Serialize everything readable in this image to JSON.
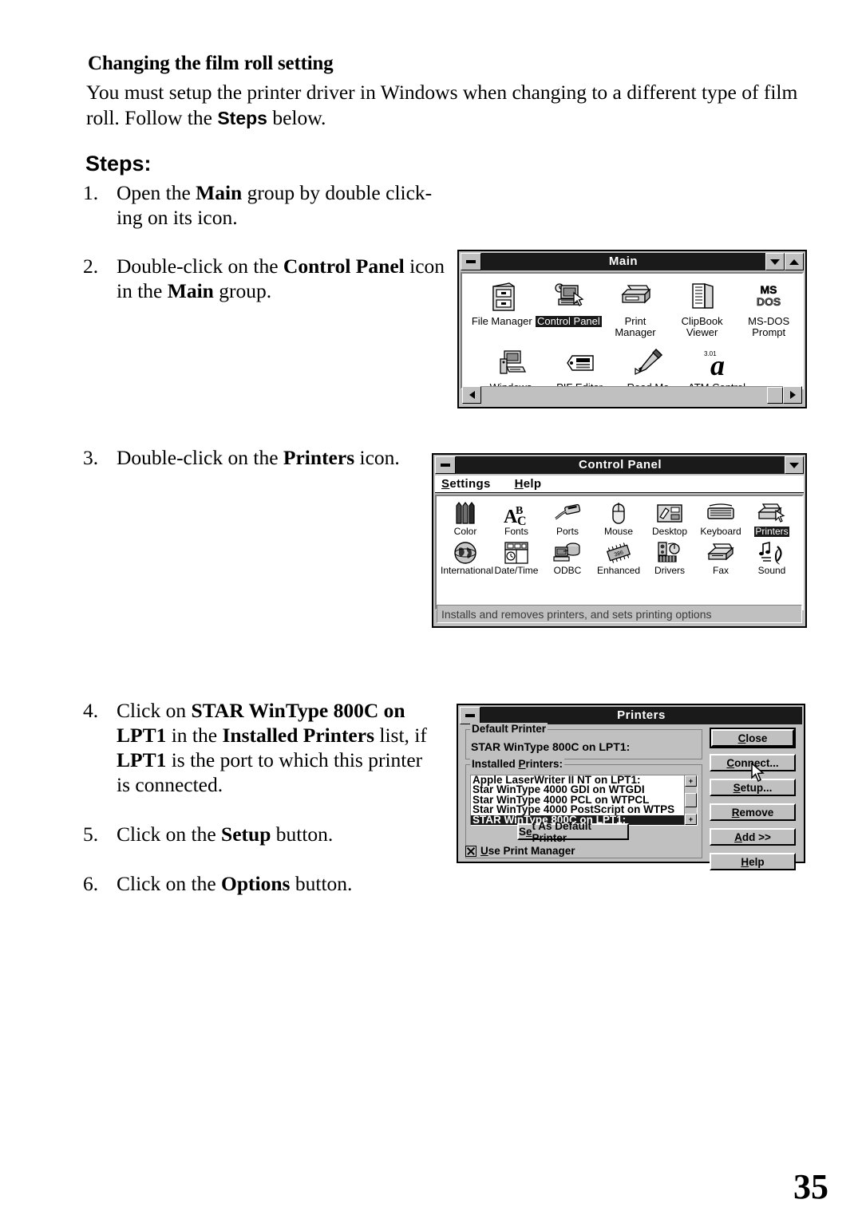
{
  "document": {
    "heading": "Changing the film roll setting",
    "intro_line1": "You must setup the printer driver in Windows when changing to a different type of film",
    "intro_line2_pre": "roll.  Follow the ",
    "intro_line2_bold": "Steps",
    "intro_line2_post": " below.",
    "steps_heading": "Steps:",
    "page_number": "35",
    "steps": [
      {
        "num": "1.",
        "parts": [
          {
            "t": "Open the ",
            "b": false
          },
          {
            "t": "Main",
            "b": true
          },
          {
            "t": " group by double click-",
            "b": false
          },
          {
            "t": "ing on its icon.",
            "b": false
          }
        ]
      },
      {
        "num": "2.",
        "parts": [
          {
            "t": "Double-click on the ",
            "b": false
          },
          {
            "t": "Control Panel",
            "b": true
          },
          {
            "t": " icon in the ",
            "b": false
          },
          {
            "t": "Main",
            "b": true
          },
          {
            "t": " group.",
            "b": false
          }
        ]
      },
      {
        "num": "3.",
        "parts": [
          {
            "t": "Double-click on the ",
            "b": false
          },
          {
            "t": "Printers",
            "b": true
          },
          {
            "t": " icon.",
            "b": false
          }
        ]
      },
      {
        "num": "4.",
        "parts": [
          {
            "t": "Click on ",
            "b": false
          },
          {
            "t": "STAR WinType 800C on LPT1",
            "b": true
          },
          {
            "t": " in the ",
            "b": false
          },
          {
            "t": "Installed Printers",
            "b": true
          },
          {
            "t": " list, if ",
            "b": false
          },
          {
            "t": "LPT1",
            "b": true
          },
          {
            "t": " is the port to which this printer is connected.",
            "b": false
          }
        ]
      },
      {
        "num": "5.",
        "parts": [
          {
            "t": "Click on the ",
            "b": false
          },
          {
            "t": "Setup",
            "b": true
          },
          {
            "t": " button.",
            "b": false
          }
        ]
      },
      {
        "num": "6.",
        "parts": [
          {
            "t": "Click on the ",
            "b": false
          },
          {
            "t": "Options",
            "b": true
          },
          {
            "t": " button.",
            "b": false
          }
        ]
      }
    ]
  },
  "main_window": {
    "title": "Main",
    "minimize_label": "minimize",
    "restore_label": "restore",
    "maximize_label": "maximize",
    "icons_row1": [
      {
        "label": "File Manager",
        "icon": "file-cabinet-icon",
        "selected": false
      },
      {
        "label": "Control Panel",
        "icon": "control-panel-icon",
        "selected": true
      },
      {
        "label": "Print Manager",
        "icon": "printer-icon",
        "selected": false
      },
      {
        "label": "ClipBook Viewer",
        "icon": "clipbook-icon",
        "selected": false
      },
      {
        "label": "MS-DOS Prompt",
        "icon": "msdos-icon",
        "selected": false
      }
    ],
    "icons_row2": [
      {
        "label": "Windows Setup",
        "icon": "windows-setup-icon",
        "selected": false
      },
      {
        "label": "PIF Editor",
        "icon": "pif-editor-icon",
        "selected": false
      },
      {
        "label": "Read Me",
        "icon": "readme-pen-icon",
        "selected": false
      },
      {
        "label": "ATM Control Panel",
        "icon": "atm-a-icon",
        "selected": false
      }
    ],
    "scroll_left": "◄",
    "scroll_right": "►"
  },
  "control_panel_window": {
    "title": "Control Panel",
    "menus": [
      {
        "accel": "S",
        "rest": "ettings"
      },
      {
        "accel": "H",
        "rest": "elp"
      }
    ],
    "icons_row1": [
      {
        "label": "Color",
        "icon": "crayons-icon",
        "selected": false
      },
      {
        "label": "Fonts",
        "icon": "fonts-abc-icon",
        "selected": false
      },
      {
        "label": "Ports",
        "icon": "ports-plug-icon",
        "selected": false
      },
      {
        "label": "Mouse",
        "icon": "mouse-icon",
        "selected": false
      },
      {
        "label": "Desktop",
        "icon": "desktop-icon",
        "selected": false
      },
      {
        "label": "Keyboard",
        "icon": "keyboard-icon",
        "selected": false
      },
      {
        "label": "Printers",
        "icon": "printers-icon",
        "selected": true
      }
    ],
    "icons_row2": [
      {
        "label": "International",
        "icon": "globe-icon",
        "selected": false
      },
      {
        "label": "Date/Time",
        "icon": "date-time-icon",
        "selected": false
      },
      {
        "label": "ODBC",
        "icon": "odbc-icon",
        "selected": false
      },
      {
        "label": "Enhanced",
        "icon": "chip-icon",
        "selected": false
      },
      {
        "label": "Drivers",
        "icon": "drivers-icon",
        "selected": false
      },
      {
        "label": "Fax",
        "icon": "fax-icon",
        "selected": false
      },
      {
        "label": "Sound",
        "icon": "sound-icon",
        "selected": false
      }
    ],
    "status_text": "Installs and removes printers, and sets printing options"
  },
  "printers_dialog": {
    "title": "Printers",
    "default_printer_group": "Default Printer",
    "default_printer_value": "STAR WinType 800C on LPT1:",
    "installed_printers_group_accel": "P",
    "installed_printers_group_pre": "Installed ",
    "installed_printers_group_post": "rinters:",
    "installed_printers": [
      {
        "label": "Apple LaserWriter II NT on LPT1:",
        "selected": false
      },
      {
        "label": "Star WinType 4000 GDI on WTGDI",
        "selected": false
      },
      {
        "label": "Star WinType 4000 PCL on WTPCL",
        "selected": false
      },
      {
        "label": "Star WinType 4000 PostScript on WTPS",
        "selected": false
      },
      {
        "label": "STAR WinType 800C on LPT1:",
        "selected": true
      }
    ],
    "scroll_up": "↑",
    "scroll_down": "↓",
    "set_default_button": {
      "pre": "S",
      "accel": "e",
      "post": "t As Default Printer"
    },
    "buttons": [
      {
        "pre": "",
        "accel": "C",
        "post": "lose",
        "default": true
      },
      {
        "pre": "",
        "accel": "C",
        "post": "onnect..."
      },
      {
        "pre": "",
        "accel": "S",
        "post": "etup..."
      },
      {
        "pre": "",
        "accel": "R",
        "post": "emove"
      },
      {
        "pre": "",
        "accel": "A",
        "post": "dd >>"
      },
      {
        "pre": "",
        "accel": "H",
        "post": "elp"
      }
    ],
    "use_print_manager_accel": "U",
    "use_print_manager_post": "se Print Manager",
    "use_print_manager_checked": true
  },
  "colors": {
    "window_face": "#c0c0c0",
    "titlebar": "#1a1a1a",
    "selection": "#1a1a1a",
    "client_bg": "#ffffff",
    "text": "#000000"
  }
}
